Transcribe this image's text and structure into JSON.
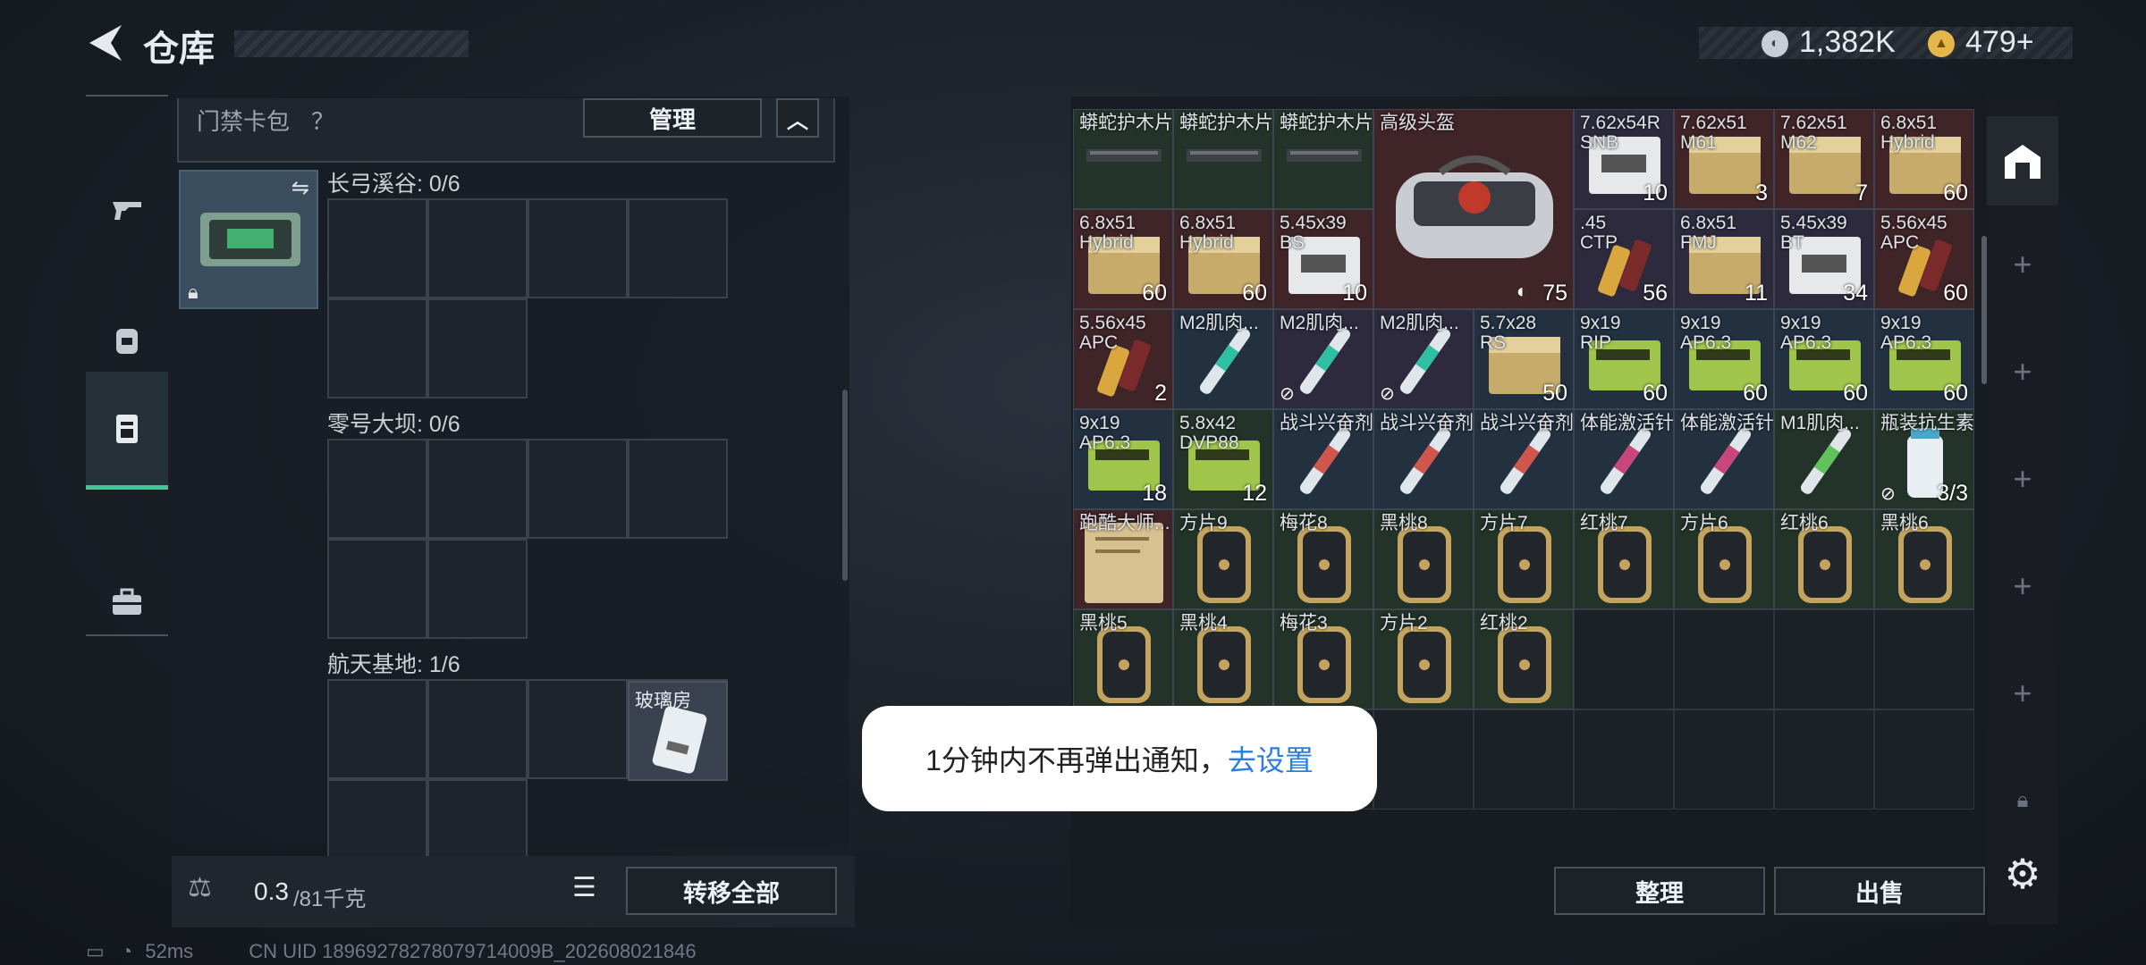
{
  "header": {
    "title": "仓库",
    "currency1": "1,382K",
    "currency2": "479+"
  },
  "nav": {
    "items": [
      "weapons",
      "gear",
      "keycard",
      "toolbox"
    ]
  },
  "keycard_bag": {
    "title": "门禁卡包",
    "help": "？",
    "manage": "管理"
  },
  "sections": [
    {
      "label": "长弓溪谷: 0/6"
    },
    {
      "label": "零号大坝: 0/6"
    },
    {
      "label": "航天基地: 1/6",
      "item_name": "玻璃房"
    }
  ],
  "footer": {
    "weight": "0.3",
    "capacity": "/81千克",
    "transfer_all": "转移全部",
    "sort": "整理",
    "sell": "出售"
  },
  "grid_items": [
    {
      "name": "蟒蛇护木片",
      "count": "",
      "color": "c-green",
      "r": 0,
      "c": 0,
      "icon": "rail"
    },
    {
      "name": "蟒蛇护木片",
      "count": "",
      "color": "c-green",
      "r": 0,
      "c": 1,
      "icon": "rail"
    },
    {
      "name": "蟒蛇护木片",
      "count": "",
      "color": "c-green",
      "r": 0,
      "c": 2,
      "icon": "rail"
    },
    {
      "name": "7.62x54R\nSNB",
      "count": "10",
      "color": "c-purple",
      "r": 0,
      "c": 5,
      "icon": "ammo-white"
    },
    {
      "name": "7.62x51\nM61",
      "count": "3",
      "color": "c-red",
      "r": 0,
      "c": 6,
      "icon": "ammo"
    },
    {
      "name": "7.62x51\nM62",
      "count": "7",
      "color": "c-red",
      "r": 0,
      "c": 7,
      "icon": "ammo"
    },
    {
      "name": "6.8x51\nHybrid",
      "count": "60",
      "color": "c-red",
      "r": 0,
      "c": 8,
      "icon": "ammo"
    },
    {
      "name": "6.8x51\nHybrid",
      "count": "60",
      "color": "c-red",
      "r": 1,
      "c": 0,
      "icon": "ammo"
    },
    {
      "name": "6.8x51\nHybrid",
      "count": "60",
      "color": "c-red",
      "r": 1,
      "c": 1,
      "icon": "ammo"
    },
    {
      "name": "5.45x39\nBS",
      "count": "10",
      "color": "c-red",
      "r": 1,
      "c": 2,
      "icon": "ammo-white"
    },
    {
      "name": ".45\nCTP",
      "count": "56",
      "color": "c-purple",
      "r": 1,
      "c": 5,
      "icon": "bullet"
    },
    {
      "name": "6.8x51\nFMJ",
      "count": "11",
      "color": "c-purple",
      "r": 1,
      "c": 6,
      "icon": "ammo"
    },
    {
      "name": "5.45x39\nBT",
      "count": "34",
      "color": "c-purple",
      "r": 1,
      "c": 7,
      "icon": "ammo-white"
    },
    {
      "name": "5.56x45\nAPC",
      "count": "60",
      "color": "c-red",
      "r": 1,
      "c": 8,
      "icon": "bullet"
    },
    {
      "name": "5.56x45\nAPC",
      "count": "2",
      "color": "c-red",
      "r": 2,
      "c": 0,
      "icon": "bullet"
    },
    {
      "name": "M2肌肉...",
      "count": "",
      "color": "c-blue",
      "r": 2,
      "c": 1,
      "icon": "syringe-teal"
    },
    {
      "name": "M2肌肉...",
      "count": "",
      "color": "c-purple",
      "r": 2,
      "c": 2,
      "icon": "syringe-teal",
      "badge": true
    },
    {
      "name": "M2肌肉...",
      "count": "",
      "color": "c-purple",
      "r": 2,
      "c": 3,
      "icon": "syringe-teal",
      "badge": true
    },
    {
      "name": "5.7x28\nRS",
      "count": "50",
      "color": "c-blue",
      "r": 2,
      "c": 4,
      "icon": "ammo"
    },
    {
      "name": "9x19\nRIP",
      "count": "60",
      "color": "c-blue",
      "r": 2,
      "c": 5,
      "icon": "ammo-green"
    },
    {
      "name": "9x19\nAP6.3",
      "count": "60",
      "color": "c-blue",
      "r": 2,
      "c": 6,
      "icon": "ammo-green"
    },
    {
      "name": "9x19\nAP6.3",
      "count": "60",
      "color": "c-blue",
      "r": 2,
      "c": 7,
      "icon": "ammo-green"
    },
    {
      "name": "9x19\nAP6.3",
      "count": "60",
      "color": "c-blue",
      "r": 2,
      "c": 8,
      "icon": "ammo-green"
    },
    {
      "name": "9x19\nAP6.3",
      "count": "18",
      "color": "c-blue",
      "r": 3,
      "c": 0,
      "icon": "ammo-green"
    },
    {
      "name": "5.8x42\nDVP88",
      "count": "12",
      "color": "c-green",
      "r": 3,
      "c": 1,
      "icon": "ammo-green"
    },
    {
      "name": "战斗兴奋剂",
      "count": "",
      "color": "c-blue",
      "r": 3,
      "c": 2,
      "icon": "syringe-red"
    },
    {
      "name": "战斗兴奋剂",
      "count": "",
      "color": "c-blue",
      "r": 3,
      "c": 3,
      "icon": "syringe-red"
    },
    {
      "name": "战斗兴奋剂",
      "count": "",
      "color": "c-blue",
      "r": 3,
      "c": 4,
      "icon": "syringe-red"
    },
    {
      "name": "体能激活针",
      "count": "",
      "color": "c-blue",
      "r": 3,
      "c": 5,
      "icon": "syringe-pink"
    },
    {
      "name": "体能激活针",
      "count": "",
      "color": "c-blue",
      "r": 3,
      "c": 6,
      "icon": "syringe-pink"
    },
    {
      "name": "M1肌肉...",
      "count": "",
      "color": "c-green",
      "r": 3,
      "c": 7,
      "icon": "syringe-green"
    },
    {
      "name": "瓶装抗生素",
      "count": "3/3",
      "color": "c-green",
      "r": 3,
      "c": 8,
      "icon": "bottle",
      "badge": true
    },
    {
      "name": "跑酷大师...",
      "count": "",
      "color": "c-red",
      "r": 4,
      "c": 0,
      "icon": "paper"
    },
    {
      "name": "方片9",
      "count": "",
      "color": "c-green",
      "r": 4,
      "c": 1,
      "icon": "card"
    },
    {
      "name": "梅花8",
      "count": "",
      "color": "c-green",
      "r": 4,
      "c": 2,
      "icon": "card"
    },
    {
      "name": "黑桃8",
      "count": "",
      "color": "c-green",
      "r": 4,
      "c": 3,
      "icon": "card"
    },
    {
      "name": "方片7",
      "count": "",
      "color": "c-green",
      "r": 4,
      "c": 4,
      "icon": "card"
    },
    {
      "name": "红桃7",
      "count": "",
      "color": "c-green",
      "r": 4,
      "c": 5,
      "icon": "card"
    },
    {
      "name": "方片6",
      "count": "",
      "color": "c-green",
      "r": 4,
      "c": 6,
      "icon": "card"
    },
    {
      "name": "红桃6",
      "count": "",
      "color": "c-green",
      "r": 4,
      "c": 7,
      "icon": "card"
    },
    {
      "name": "黑桃6",
      "count": "",
      "color": "c-green",
      "r": 4,
      "c": 8,
      "icon": "card"
    },
    {
      "name": "黑桃5",
      "count": "",
      "color": "c-green",
      "r": 5,
      "c": 0,
      "icon": "card"
    },
    {
      "name": "黑桃4",
      "count": "",
      "color": "c-green",
      "r": 5,
      "c": 1,
      "icon": "card"
    },
    {
      "name": "梅花3",
      "count": "",
      "color": "c-green",
      "r": 5,
      "c": 2,
      "icon": "card"
    },
    {
      "name": "方片2",
      "count": "",
      "color": "c-green",
      "r": 5,
      "c": 3,
      "icon": "card"
    },
    {
      "name": "红桃2",
      "count": "",
      "color": "c-green",
      "r": 5,
      "c": 4,
      "icon": "card"
    }
  ],
  "big_item": {
    "name": "高级头盔",
    "count": "75"
  },
  "toast": {
    "text": "1分钟内不再弹出通知，",
    "link": "去设置"
  },
  "status": {
    "ping": "52ms",
    "uid": "CN UID 18969278278079714009B_202608021846"
  }
}
